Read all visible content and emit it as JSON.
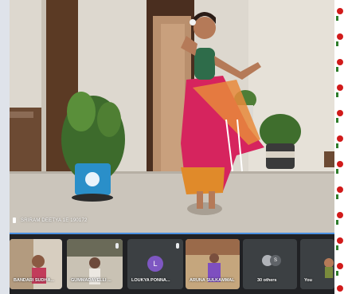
{
  "main_video": {
    "participant_name": "SRIRAM DEETYA 1E 190172"
  },
  "participants_strip": [
    {
      "name": "BANDARI SUDHA..."
    },
    {
      "name": "GUMMADAVELLI ..."
    },
    {
      "name": "LOUKYA PONNA...",
      "initial": "L"
    },
    {
      "name": "ARUNA SULKAMMAL"
    },
    {
      "name": "30 others",
      "initial": "S"
    },
    {
      "name": "You"
    }
  ],
  "colors": {
    "accent_bar": "#4a90e2",
    "tile_bg": "#3c4043",
    "loukya_avatar": "#7e57c2",
    "others_avatar": "#5f6368"
  }
}
